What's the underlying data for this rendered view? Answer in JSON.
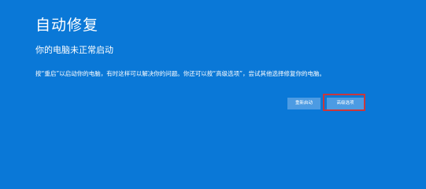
{
  "page": {
    "title": "自动修复",
    "subtitle": "你的电脑未正常启动",
    "message": "按“重启”以启动你的电脑，有时这样可以解决你的问题。你还可以按“高级选项”，尝试其他选择修复你的电脑。"
  },
  "buttons": {
    "restart_label": "重新启动",
    "advanced_label": "高级选项"
  },
  "colors": {
    "background": "#0a78d7",
    "button": "#4c9be3",
    "highlight": "#c9373c",
    "text": "#ffffff"
  }
}
